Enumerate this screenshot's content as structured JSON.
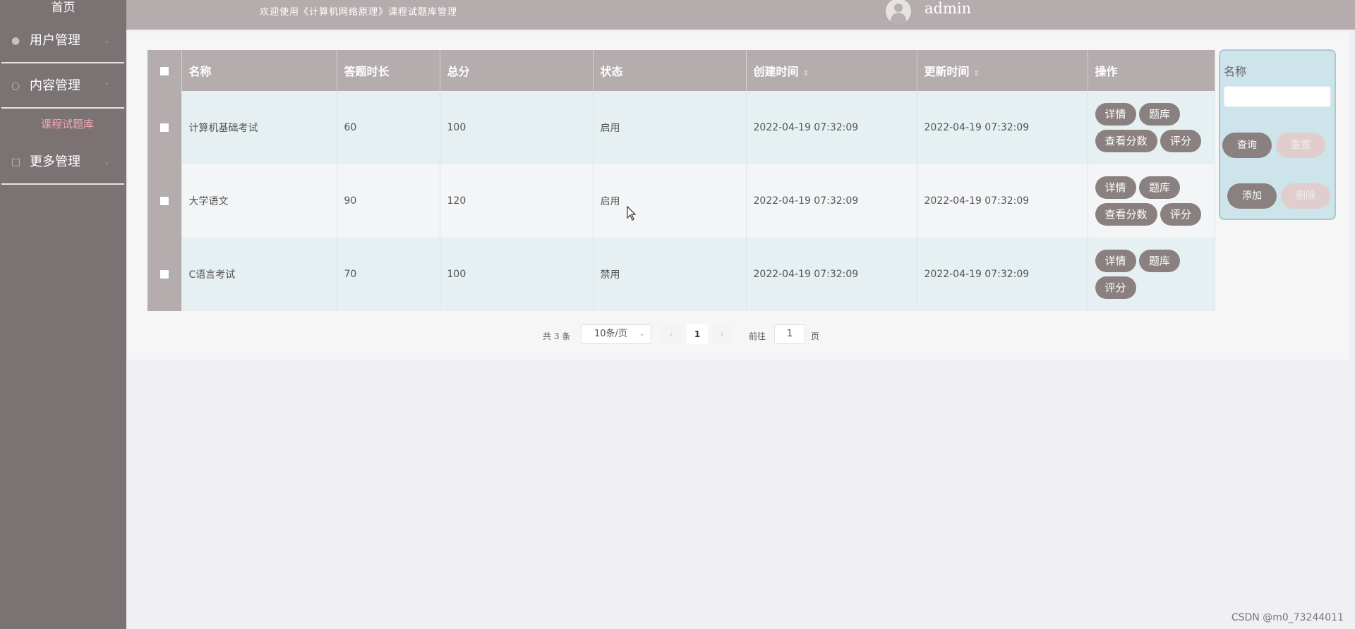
{
  "sidebar": {
    "home": "首页",
    "menus": [
      {
        "label": "用户管理",
        "icon": "user-icon"
      },
      {
        "label": "内容管理",
        "icon": "content-icon"
      },
      {
        "label": "更多管理",
        "icon": "more-icon"
      }
    ],
    "submenu": "课程试题库"
  },
  "header": {
    "welcome": "欢迎使用《计算机网络原理》课程试题库管理",
    "username": "admin"
  },
  "table": {
    "columns": [
      "名称",
      "答题时长",
      "总分",
      "状态",
      "创建时间",
      "更新时间",
      "操作"
    ],
    "rows": [
      {
        "name": "计算机基础考试",
        "duration": "60",
        "score": "100",
        "status": "启用",
        "created": "2022-04-19 07:32:09",
        "updated": "2022-04-19 07:32:09",
        "actions": [
          "详情",
          "题库",
          "查看分数",
          "评分"
        ]
      },
      {
        "name": "大学语文",
        "duration": "90",
        "score": "120",
        "status": "启用",
        "created": "2022-04-19 07:32:09",
        "updated": "2022-04-19 07:32:09",
        "actions": [
          "详情",
          "题库",
          "查看分数",
          "评分"
        ]
      },
      {
        "name": "C语言考试",
        "duration": "70",
        "score": "100",
        "status": "禁用",
        "created": "2022-04-19 07:32:09",
        "updated": "2022-04-19 07:32:09",
        "actions": [
          "详情",
          "题库",
          "评分"
        ]
      }
    ]
  },
  "pagination": {
    "total": "共 3 条",
    "page_size": "10条/页",
    "current_page": "1",
    "goto_label": "前往",
    "goto_value": "1",
    "page_unit": "页"
  },
  "search": {
    "label": "名称",
    "query": "查询",
    "reset": "重置",
    "add": "添加",
    "delete": "删除"
  },
  "watermark": "CSDN @m0_73244011"
}
